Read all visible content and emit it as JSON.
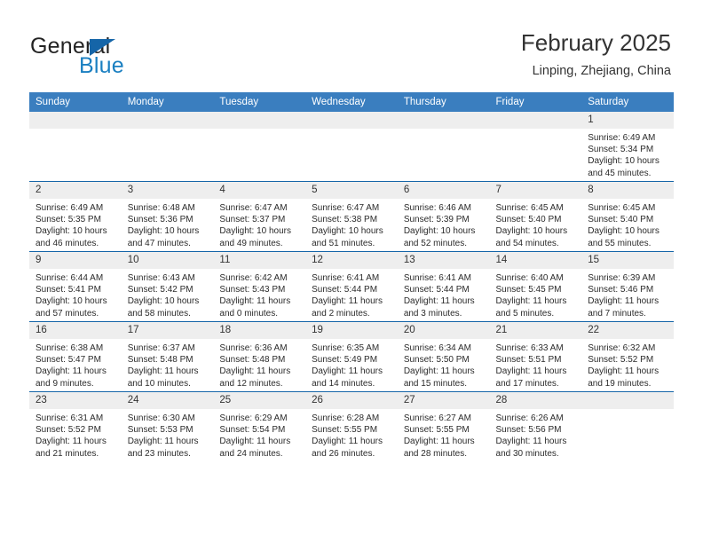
{
  "brand": {
    "word_one": "General",
    "word_two": "Blue",
    "triangle_color": "#1565a8",
    "blue_color": "#1a7fc1"
  },
  "header": {
    "month_title": "February 2025",
    "location": "Linping, Zhejiang, China"
  },
  "theme": {
    "header_row_bg": "#3a7ebf",
    "daynum_bg": "#eeeeee",
    "row_divider": "#1565a8"
  },
  "calendar": {
    "weekday_headers": [
      "Sunday",
      "Monday",
      "Tuesday",
      "Wednesday",
      "Thursday",
      "Friday",
      "Saturday"
    ],
    "weeks": [
      [
        {
          "day": "",
          "sunrise": "",
          "sunset": "",
          "daylight1": "",
          "daylight2": ""
        },
        {
          "day": "",
          "sunrise": "",
          "sunset": "",
          "daylight1": "",
          "daylight2": ""
        },
        {
          "day": "",
          "sunrise": "",
          "sunset": "",
          "daylight1": "",
          "daylight2": ""
        },
        {
          "day": "",
          "sunrise": "",
          "sunset": "",
          "daylight1": "",
          "daylight2": ""
        },
        {
          "day": "",
          "sunrise": "",
          "sunset": "",
          "daylight1": "",
          "daylight2": ""
        },
        {
          "day": "",
          "sunrise": "",
          "sunset": "",
          "daylight1": "",
          "daylight2": ""
        },
        {
          "day": "1",
          "sunrise": "Sunrise: 6:49 AM",
          "sunset": "Sunset: 5:34 PM",
          "daylight1": "Daylight: 10 hours",
          "daylight2": "and 45 minutes."
        }
      ],
      [
        {
          "day": "2",
          "sunrise": "Sunrise: 6:49 AM",
          "sunset": "Sunset: 5:35 PM",
          "daylight1": "Daylight: 10 hours",
          "daylight2": "and 46 minutes."
        },
        {
          "day": "3",
          "sunrise": "Sunrise: 6:48 AM",
          "sunset": "Sunset: 5:36 PM",
          "daylight1": "Daylight: 10 hours",
          "daylight2": "and 47 minutes."
        },
        {
          "day": "4",
          "sunrise": "Sunrise: 6:47 AM",
          "sunset": "Sunset: 5:37 PM",
          "daylight1": "Daylight: 10 hours",
          "daylight2": "and 49 minutes."
        },
        {
          "day": "5",
          "sunrise": "Sunrise: 6:47 AM",
          "sunset": "Sunset: 5:38 PM",
          "daylight1": "Daylight: 10 hours",
          "daylight2": "and 51 minutes."
        },
        {
          "day": "6",
          "sunrise": "Sunrise: 6:46 AM",
          "sunset": "Sunset: 5:39 PM",
          "daylight1": "Daylight: 10 hours",
          "daylight2": "and 52 minutes."
        },
        {
          "day": "7",
          "sunrise": "Sunrise: 6:45 AM",
          "sunset": "Sunset: 5:40 PM",
          "daylight1": "Daylight: 10 hours",
          "daylight2": "and 54 minutes."
        },
        {
          "day": "8",
          "sunrise": "Sunrise: 6:45 AM",
          "sunset": "Sunset: 5:40 PM",
          "daylight1": "Daylight: 10 hours",
          "daylight2": "and 55 minutes."
        }
      ],
      [
        {
          "day": "9",
          "sunrise": "Sunrise: 6:44 AM",
          "sunset": "Sunset: 5:41 PM",
          "daylight1": "Daylight: 10 hours",
          "daylight2": "and 57 minutes."
        },
        {
          "day": "10",
          "sunrise": "Sunrise: 6:43 AM",
          "sunset": "Sunset: 5:42 PM",
          "daylight1": "Daylight: 10 hours",
          "daylight2": "and 58 minutes."
        },
        {
          "day": "11",
          "sunrise": "Sunrise: 6:42 AM",
          "sunset": "Sunset: 5:43 PM",
          "daylight1": "Daylight: 11 hours",
          "daylight2": "and 0 minutes."
        },
        {
          "day": "12",
          "sunrise": "Sunrise: 6:41 AM",
          "sunset": "Sunset: 5:44 PM",
          "daylight1": "Daylight: 11 hours",
          "daylight2": "and 2 minutes."
        },
        {
          "day": "13",
          "sunrise": "Sunrise: 6:41 AM",
          "sunset": "Sunset: 5:44 PM",
          "daylight1": "Daylight: 11 hours",
          "daylight2": "and 3 minutes."
        },
        {
          "day": "14",
          "sunrise": "Sunrise: 6:40 AM",
          "sunset": "Sunset: 5:45 PM",
          "daylight1": "Daylight: 11 hours",
          "daylight2": "and 5 minutes."
        },
        {
          "day": "15",
          "sunrise": "Sunrise: 6:39 AM",
          "sunset": "Sunset: 5:46 PM",
          "daylight1": "Daylight: 11 hours",
          "daylight2": "and 7 minutes."
        }
      ],
      [
        {
          "day": "16",
          "sunrise": "Sunrise: 6:38 AM",
          "sunset": "Sunset: 5:47 PM",
          "daylight1": "Daylight: 11 hours",
          "daylight2": "and 9 minutes."
        },
        {
          "day": "17",
          "sunrise": "Sunrise: 6:37 AM",
          "sunset": "Sunset: 5:48 PM",
          "daylight1": "Daylight: 11 hours",
          "daylight2": "and 10 minutes."
        },
        {
          "day": "18",
          "sunrise": "Sunrise: 6:36 AM",
          "sunset": "Sunset: 5:48 PM",
          "daylight1": "Daylight: 11 hours",
          "daylight2": "and 12 minutes."
        },
        {
          "day": "19",
          "sunrise": "Sunrise: 6:35 AM",
          "sunset": "Sunset: 5:49 PM",
          "daylight1": "Daylight: 11 hours",
          "daylight2": "and 14 minutes."
        },
        {
          "day": "20",
          "sunrise": "Sunrise: 6:34 AM",
          "sunset": "Sunset: 5:50 PM",
          "daylight1": "Daylight: 11 hours",
          "daylight2": "and 15 minutes."
        },
        {
          "day": "21",
          "sunrise": "Sunrise: 6:33 AM",
          "sunset": "Sunset: 5:51 PM",
          "daylight1": "Daylight: 11 hours",
          "daylight2": "and 17 minutes."
        },
        {
          "day": "22",
          "sunrise": "Sunrise: 6:32 AM",
          "sunset": "Sunset: 5:52 PM",
          "daylight1": "Daylight: 11 hours",
          "daylight2": "and 19 minutes."
        }
      ],
      [
        {
          "day": "23",
          "sunrise": "Sunrise: 6:31 AM",
          "sunset": "Sunset: 5:52 PM",
          "daylight1": "Daylight: 11 hours",
          "daylight2": "and 21 minutes."
        },
        {
          "day": "24",
          "sunrise": "Sunrise: 6:30 AM",
          "sunset": "Sunset: 5:53 PM",
          "daylight1": "Daylight: 11 hours",
          "daylight2": "and 23 minutes."
        },
        {
          "day": "25",
          "sunrise": "Sunrise: 6:29 AM",
          "sunset": "Sunset: 5:54 PM",
          "daylight1": "Daylight: 11 hours",
          "daylight2": "and 24 minutes."
        },
        {
          "day": "26",
          "sunrise": "Sunrise: 6:28 AM",
          "sunset": "Sunset: 5:55 PM",
          "daylight1": "Daylight: 11 hours",
          "daylight2": "and 26 minutes."
        },
        {
          "day": "27",
          "sunrise": "Sunrise: 6:27 AM",
          "sunset": "Sunset: 5:55 PM",
          "daylight1": "Daylight: 11 hours",
          "daylight2": "and 28 minutes."
        },
        {
          "day": "28",
          "sunrise": "Sunrise: 6:26 AM",
          "sunset": "Sunset: 5:56 PM",
          "daylight1": "Daylight: 11 hours",
          "daylight2": "and 30 minutes."
        },
        {
          "day": "",
          "sunrise": "",
          "sunset": "",
          "daylight1": "",
          "daylight2": ""
        }
      ]
    ]
  }
}
